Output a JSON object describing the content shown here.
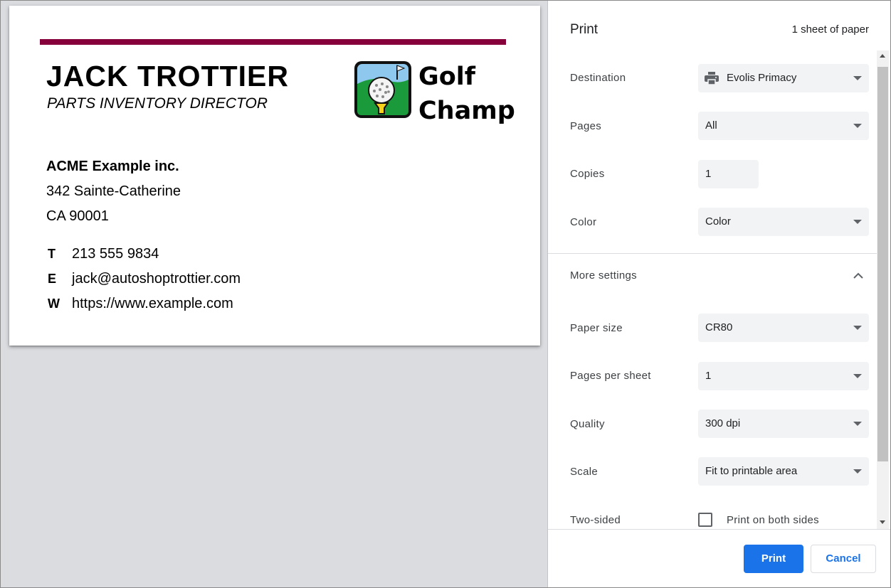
{
  "card": {
    "accent_color": "#86003c",
    "name": "JACK TROTTIER",
    "job_title": "PARTS INVENTORY DIRECTOR",
    "logo": {
      "line1": "Golf",
      "line2": "Champ",
      "icon": "golf-ball-on-tee-icon"
    },
    "company": "ACME Example inc.",
    "address_line1": "342 Sainte-Catherine",
    "address_line2": "CA 90001",
    "contacts": [
      {
        "key": "T",
        "value": "213 555 9834"
      },
      {
        "key": "E",
        "value": "jack@autoshoptrottier.com"
      },
      {
        "key": "W",
        "value": "https://www.example.com"
      }
    ]
  },
  "panel": {
    "title": "Print",
    "sheet_count": "1 sheet of paper",
    "destination": {
      "label": "Destination",
      "value": "Evolis Primacy",
      "icon": "printer-icon"
    },
    "pages": {
      "label": "Pages",
      "value": "All"
    },
    "copies": {
      "label": "Copies",
      "value": "1"
    },
    "color": {
      "label": "Color",
      "value": "Color"
    },
    "more_settings": {
      "label": "More settings",
      "icon": "chevron-up-icon"
    },
    "paper_size": {
      "label": "Paper size",
      "value": "CR80"
    },
    "pages_per_sheet": {
      "label": "Pages per sheet",
      "value": "1"
    },
    "quality": {
      "label": "Quality",
      "value": "300 dpi"
    },
    "scale": {
      "label": "Scale",
      "value": "Fit to printable area"
    },
    "two_sided": {
      "label": "Two-sided",
      "checkbox_label": "Print on both sides"
    },
    "print_button": "Print",
    "cancel_button": "Cancel",
    "accent_color": "#1a73e8"
  }
}
